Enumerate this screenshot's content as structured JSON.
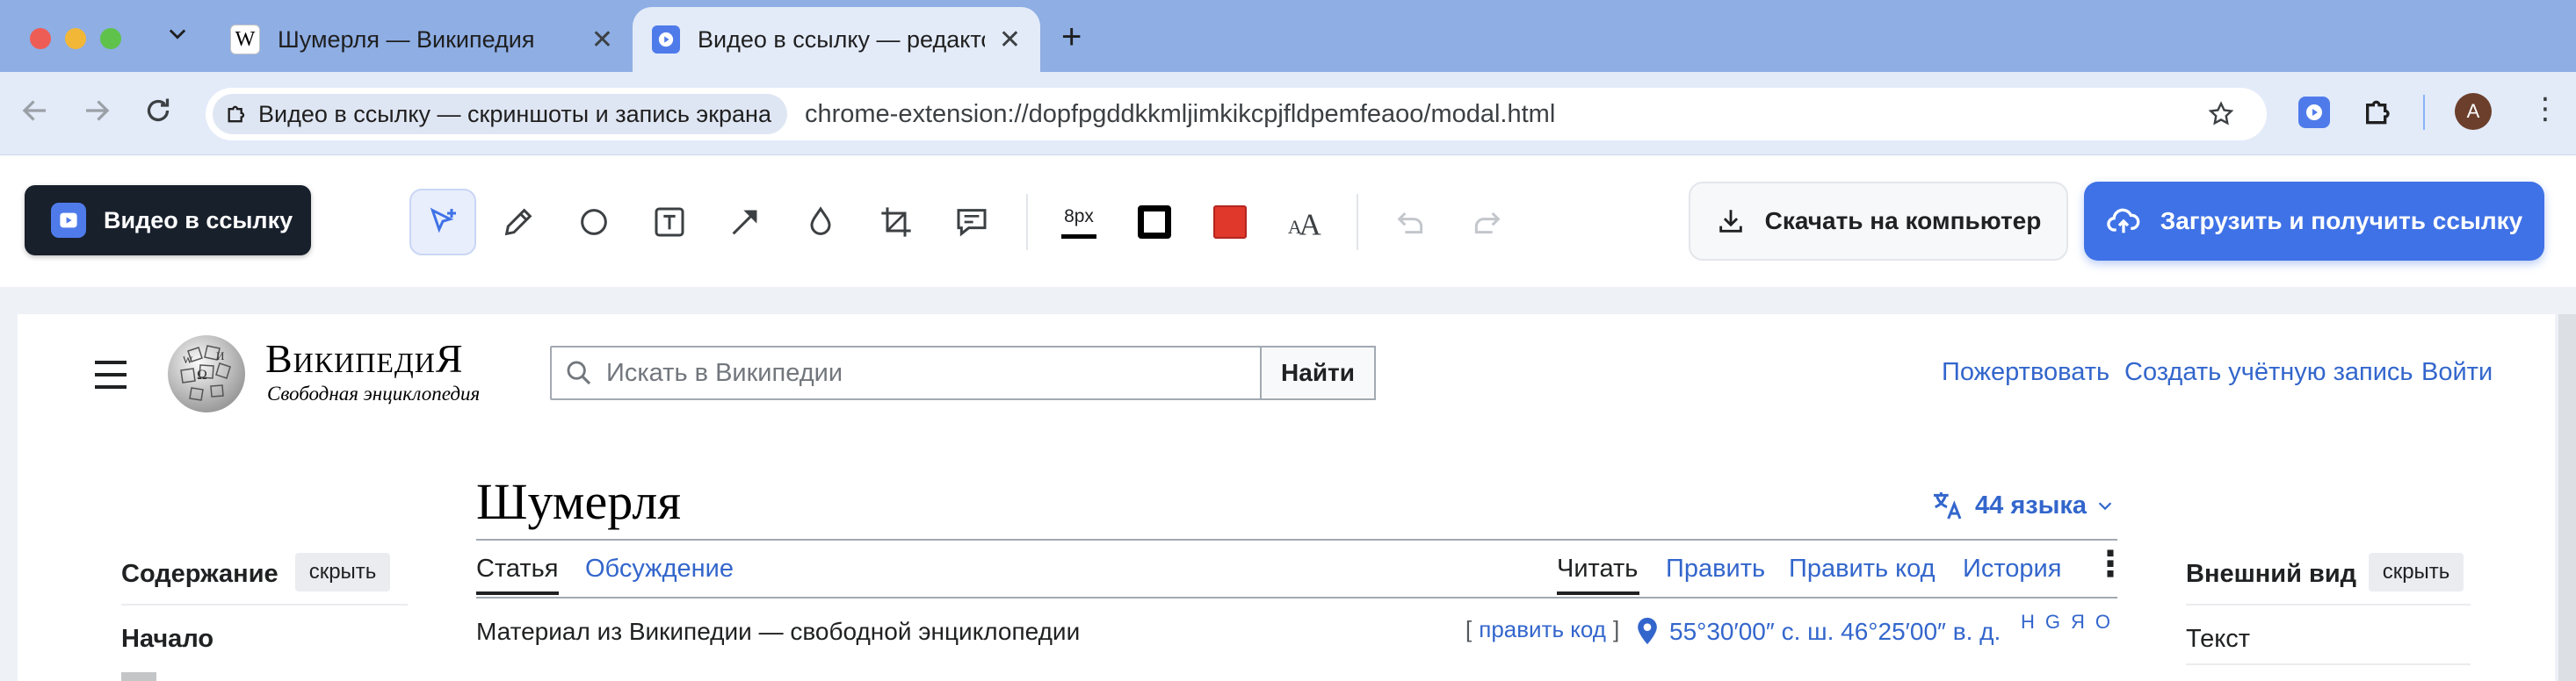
{
  "browser": {
    "tabs": [
      {
        "title": "Шумерля — Википедия",
        "favicon": "W"
      },
      {
        "title": "Видео в ссылку — редактор",
        "favicon": "extension-play-icon"
      }
    ],
    "new_tab_label": "+",
    "site_chip": "Видео в ссылку — скриншоты и запись экрана",
    "url": "chrome-extension://dopfpgddkkmljimkikcpjfldpemfeaoo/modal.html",
    "profile_initial": "A"
  },
  "editor": {
    "brand_label": "Видео в ссылку",
    "stroke_size_label": "8px",
    "colors": {
      "stroke": "#000000",
      "fill": "#e0382b",
      "accent": "#3f72e6"
    },
    "download_label": "Скачать на компьютер",
    "upload_label": "Загрузить и получить ссылку",
    "tools": [
      "select-icon",
      "pencil-icon",
      "ellipse-icon",
      "text-icon",
      "arrow-icon",
      "blur-drop-icon",
      "crop-icon",
      "comment-icon"
    ]
  },
  "wiki": {
    "logo_title": "ВикипедиЯ",
    "logo_subtitle": "Свободная энциклопедия",
    "search_placeholder": "Искать в Википедии",
    "search_button": "Найти",
    "donate": "Пожертвовать",
    "create_account": "Создать учётную запись",
    "login": "Войти",
    "article_title": "Шумерля",
    "languages": "44 языка",
    "tabs_left": [
      "Статья",
      "Обсуждение"
    ],
    "tabs_right": [
      "Читать",
      "Править",
      "Править код",
      "История"
    ],
    "tagline": "Материал из Википедии — свободной энциклопедии",
    "edit_code_open": "[",
    "edit_code": "править код",
    "edit_code_close": "]",
    "coordinates": "55°30′00″ с. ш. 46°25′00″ в. д.",
    "map_links": [
      "H",
      "G",
      "Я",
      "O"
    ],
    "toc_heading": "Содержание",
    "toc_hide": "скрыть",
    "toc_first": "Начало",
    "appearance_heading": "Внешний вид",
    "appearance_hide": "скрыть",
    "appearance_text": "Текст"
  }
}
